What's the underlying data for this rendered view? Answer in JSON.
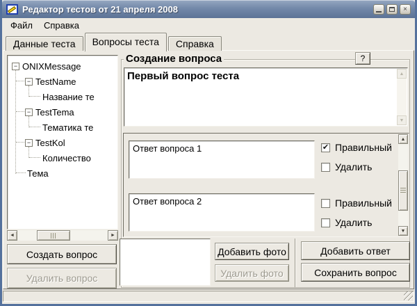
{
  "window": {
    "title": "Редактор тестов от 21 апреля 2008"
  },
  "titlebar_icons": {
    "close": "×"
  },
  "menu": {
    "file": "Файл",
    "help": "Справка"
  },
  "tabs": {
    "tab1": "Данные теста",
    "tab2": "Вопросы теста",
    "tab3": "Справка"
  },
  "tree": {
    "items": [
      {
        "label": "ONIXMessage",
        "level": 0,
        "expanded": true
      },
      {
        "label": "TestName",
        "level": 1,
        "expanded": true
      },
      {
        "label": "Название те",
        "level": 2
      },
      {
        "label": "TestTema",
        "level": 1,
        "expanded": true
      },
      {
        "label": "Тематика те",
        "level": 2
      },
      {
        "label": "TestKol",
        "level": 1,
        "expanded": true
      },
      {
        "label": "Количество",
        "level": 2
      },
      {
        "label": "Тема",
        "level": 1
      }
    ]
  },
  "question_group": {
    "title": "Создание вопроса",
    "help_button": "?",
    "question_text": "Первый вопрос теста"
  },
  "answers": {
    "a1": {
      "text": "Ответ вопроса 1",
      "correct_label": "Правильный",
      "correct_checked": true,
      "correct_check": "✔",
      "delete_label": "Удалить",
      "delete_checked": false,
      "delete_check": ""
    },
    "a2": {
      "text": "Ответ вопроса 2",
      "correct_label": "Правильный",
      "correct_checked": false,
      "correct_check": "",
      "delete_label": "Удалить",
      "delete_checked": false,
      "delete_check": ""
    }
  },
  "buttons": {
    "create_question": "Создать вопрос",
    "delete_question": "Удалить вопрос",
    "add_photo": "Добавить фото",
    "delete_photo": "Удалить фото",
    "add_answer": "Добавить ответ",
    "save_question": "Сохранить вопрос"
  },
  "icons": {
    "arrow_up": "▲",
    "arrow_down": "▼",
    "arrow_left": "◄",
    "arrow_right": "►",
    "collapse": "−"
  },
  "colors": {
    "titlebar_top": "#93a5bf",
    "titlebar_bottom": "#5c7396",
    "frame": "#54719d",
    "surface": "#ece9e2"
  }
}
